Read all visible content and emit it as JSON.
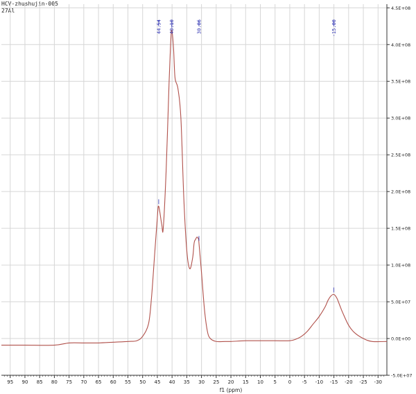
{
  "header": {
    "sample_name": "HCV-zhushujin-005",
    "nucleus": "27Al"
  },
  "colors": {
    "grid": "#d6d6d6",
    "axis": "#333333",
    "spectrum": "#b0504a",
    "peak_label": "#2b2fb0",
    "background": "#ffffff"
  },
  "chart_data": {
    "type": "line",
    "title": "",
    "xlabel": "f1 (ppm)",
    "ylabel": "",
    "xlim": [
      98,
      -33
    ],
    "ylim": [
      -50000000,
      455000000
    ],
    "x_reversed": true,
    "grid": "on",
    "x_ticks": [
      95,
      90,
      85,
      80,
      75,
      70,
      65,
      60,
      55,
      50,
      45,
      40,
      35,
      30,
      25,
      20,
      15,
      10,
      5,
      0,
      -5,
      -10,
      -15,
      -20,
      -25,
      -30
    ],
    "x_tick_labels": [
      "95",
      "90",
      "85",
      "80",
      "75",
      "70",
      "65",
      "60",
      "55",
      "50",
      "45",
      "40",
      "35",
      "30",
      "25",
      "20",
      "15",
      "10",
      "5",
      "0",
      "-5",
      "-10",
      "-15",
      "-20",
      "-25",
      "-30"
    ],
    "y_ticks": [
      -50000000,
      0,
      50000000,
      100000000,
      150000000,
      200000000,
      250000000,
      300000000,
      350000000,
      400000000,
      450000000
    ],
    "y_tick_labels": [
      "-5.0E+07",
      "0.0E+00",
      "5.0E+07",
      "1.0E+08",
      "1.5E+08",
      "2.0E+08",
      "2.5E+08",
      "3.0E+08",
      "3.5E+08",
      "4.0E+08",
      "4.5E+08"
    ],
    "peak_labels": [
      {
        "label": "44.54",
        "x": 44.54
      },
      {
        "label": "40.10",
        "x": 40.1
      },
      {
        "label": "30.86",
        "x": 30.86
      },
      {
        "label": "-15.00",
        "x": -15.0
      }
    ],
    "series": [
      {
        "x": [
          98,
          90,
          80,
          75,
          70,
          65,
          60,
          55,
          52,
          50,
          48,
          47,
          46,
          45,
          44.54,
          43.5,
          43,
          42,
          41,
          40.5,
          40.1,
          39.5,
          39,
          38,
          37,
          36,
          35,
          34,
          33,
          32.5,
          32,
          31.5,
          31,
          30.86,
          30,
          29,
          28,
          27,
          25,
          22,
          20,
          15,
          10,
          5,
          0,
          -2,
          -4,
          -6,
          -8,
          -10,
          -12,
          -13,
          -14,
          -15,
          -16,
          -17,
          -18,
          -20,
          -22,
          -25,
          -28,
          -33
        ],
        "y": [
          -9000000,
          -9000000,
          -9000000,
          -6000000,
          -6000000,
          -6000000,
          -5000000,
          -4000000,
          -3000000,
          3000000,
          20000000,
          55000000,
          110000000,
          165000000,
          180000000,
          155000000,
          150000000,
          230000000,
          350000000,
          400000000,
          420000000,
          395000000,
          355000000,
          340000000,
          300000000,
          190000000,
          120000000,
          95000000,
          110000000,
          130000000,
          135000000,
          138000000,
          135000000,
          130000000,
          90000000,
          40000000,
          10000000,
          0,
          -4000000,
          -4000000,
          -4000000,
          -3000000,
          -3000000,
          -3000000,
          -3000000,
          -1000000,
          3000000,
          10000000,
          20000000,
          30000000,
          43000000,
          52000000,
          58000000,
          60000000,
          55000000,
          45000000,
          35000000,
          18000000,
          8000000,
          0,
          -4000000,
          -4000000
        ]
      }
    ]
  }
}
